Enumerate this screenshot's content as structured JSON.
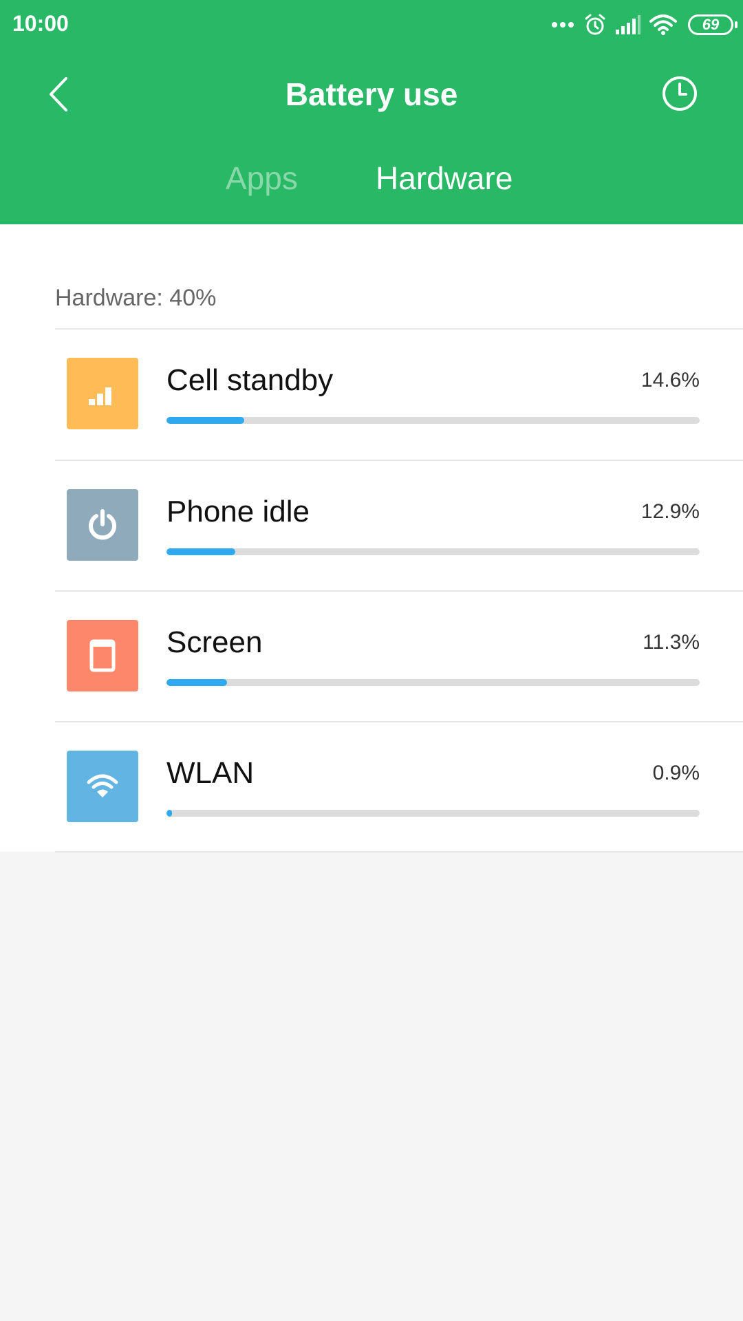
{
  "status_bar": {
    "time": "10:00",
    "battery_level": "69",
    "icons": [
      "more-dots-icon",
      "alarm-icon",
      "signal-icon",
      "wifi-icon",
      "battery-icon"
    ]
  },
  "header": {
    "title": "Battery use",
    "back_icon": "chevron-left-icon",
    "history_icon": "clock-icon"
  },
  "tabs": [
    {
      "label": "Apps",
      "active": false
    },
    {
      "label": "Hardware",
      "active": true
    }
  ],
  "section": {
    "label": "Hardware: 40%"
  },
  "items": [
    {
      "name": "Cell standby",
      "percent": "14.6%",
      "value": 14.6,
      "icon": "signal-bars-icon",
      "color": "#ffbb55"
    },
    {
      "name": "Phone idle",
      "percent": "12.9%",
      "value": 12.9,
      "icon": "power-icon",
      "color": "#8eaabb"
    },
    {
      "name": "Screen",
      "percent": "11.3%",
      "value": 11.3,
      "icon": "screen-icon",
      "color": "#fd876a"
    },
    {
      "name": "WLAN",
      "percent": "0.9%",
      "value": 0.9,
      "icon": "wifi-icon",
      "color": "#62b5e3"
    }
  ],
  "colors": {
    "header": "#29b865",
    "progress": "#2ea9f0",
    "track": "#dcdcdc"
  }
}
